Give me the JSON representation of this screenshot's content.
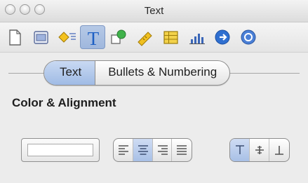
{
  "window": {
    "title": "Text"
  },
  "toolbar": {
    "items": [
      {
        "name": "document-inspector-icon"
      },
      {
        "name": "layout-inspector-icon"
      },
      {
        "name": "wrap-inspector-icon"
      },
      {
        "name": "text-inspector-icon",
        "selected": true
      },
      {
        "name": "graphic-inspector-icon"
      },
      {
        "name": "metrics-inspector-icon"
      },
      {
        "name": "table-inspector-icon"
      },
      {
        "name": "chart-inspector-icon"
      },
      {
        "name": "link-inspector-icon"
      },
      {
        "name": "quicktime-inspector-icon"
      }
    ]
  },
  "tabs": [
    {
      "label": "Text",
      "active": true
    },
    {
      "label": "Bullets & Numbering",
      "active": false
    }
  ],
  "section": {
    "title": "Color & Alignment"
  },
  "alignment": {
    "horizontal": [
      {
        "name": "align-left-icon",
        "active": false
      },
      {
        "name": "align-center-icon",
        "active": true
      },
      {
        "name": "align-right-icon",
        "active": false
      },
      {
        "name": "align-justify-icon",
        "active": false
      }
    ],
    "vertical": [
      {
        "name": "align-top-icon",
        "active": true
      },
      {
        "name": "align-middle-icon",
        "active": false
      },
      {
        "name": "align-bottom-icon",
        "active": false
      }
    ]
  },
  "colors": {
    "selection": "#9fb7dd",
    "accent_blue": "#2f6fd0"
  }
}
